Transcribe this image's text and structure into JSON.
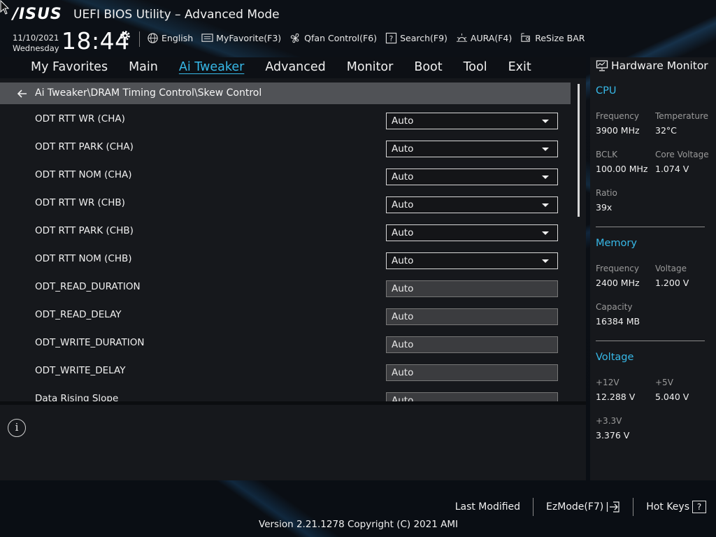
{
  "header": {
    "brand": "/ISUS",
    "title": "UEFI BIOS Utility – Advanced Mode",
    "date": "11/10/2021",
    "weekday": "Wednesday",
    "time": "18:44"
  },
  "toolbar": [
    {
      "label": "English",
      "icon": "globe-icon"
    },
    {
      "label": "MyFavorite(F3)",
      "icon": "favorite-icon"
    },
    {
      "label": "Qfan Control(F6)",
      "icon": "fan-icon"
    },
    {
      "label": "Search(F9)",
      "icon": "search-help-icon"
    },
    {
      "label": "AURA(F4)",
      "icon": "aura-icon"
    },
    {
      "label": "ReSize BAR",
      "icon": "resize-bar-icon"
    }
  ],
  "menu": {
    "items": [
      "My Favorites",
      "Main",
      "Ai Tweaker",
      "Advanced",
      "Monitor",
      "Boot",
      "Tool",
      "Exit"
    ],
    "active": "Ai Tweaker"
  },
  "breadcrumb": "Ai Tweaker\\DRAM Timing Control\\Skew Control",
  "settings": [
    {
      "label": "ODT RTT WR (CHA)",
      "value": "Auto",
      "type": "dropdown"
    },
    {
      "label": "ODT RTT PARK (CHA)",
      "value": "Auto",
      "type": "dropdown"
    },
    {
      "label": "ODT RTT NOM (CHA)",
      "value": "Auto",
      "type": "dropdown"
    },
    {
      "label": "ODT RTT WR (CHB)",
      "value": "Auto",
      "type": "dropdown"
    },
    {
      "label": "ODT RTT PARK (CHB)",
      "value": "Auto",
      "type": "dropdown"
    },
    {
      "label": "ODT RTT NOM (CHB)",
      "value": "Auto",
      "type": "dropdown"
    },
    {
      "label": "ODT_READ_DURATION",
      "value": "Auto",
      "type": "input"
    },
    {
      "label": "ODT_READ_DELAY",
      "value": "Auto",
      "type": "input"
    },
    {
      "label": "ODT_WRITE_DURATION",
      "value": "Auto",
      "type": "input"
    },
    {
      "label": "ODT_WRITE_DELAY",
      "value": "Auto",
      "type": "input"
    },
    {
      "label": "Data Rising Slope",
      "value": "Auto",
      "type": "input"
    }
  ],
  "info_icon": "i",
  "hardware_monitor": {
    "title": "Hardware Monitor",
    "cpu": {
      "title": "CPU",
      "frequency_label": "Frequency",
      "frequency": "3900 MHz",
      "temperature_label": "Temperature",
      "temperature": "32°C",
      "bclk_label": "BCLK",
      "bclk": "100.00 MHz",
      "core_voltage_label": "Core Voltage",
      "core_voltage": "1.074 V",
      "ratio_label": "Ratio",
      "ratio": "39x"
    },
    "memory": {
      "title": "Memory",
      "frequency_label": "Frequency",
      "frequency": "2400 MHz",
      "voltage_label": "Voltage",
      "voltage": "1.200 V",
      "capacity_label": "Capacity",
      "capacity": "16384 MB"
    },
    "voltage": {
      "title": "Voltage",
      "v12_label": "+12V",
      "v12": "12.288 V",
      "v5_label": "+5V",
      "v5": "5.040 V",
      "v33_label": "+3.3V",
      "v33": "3.376 V"
    }
  },
  "footer": {
    "last_modified": "Last Modified",
    "ezmode": "EzMode(F7)",
    "hotkeys": "Hot Keys",
    "hotkeys_icon": "?",
    "version": "Version 2.21.1278 Copyright (C) 2021 AMI"
  }
}
